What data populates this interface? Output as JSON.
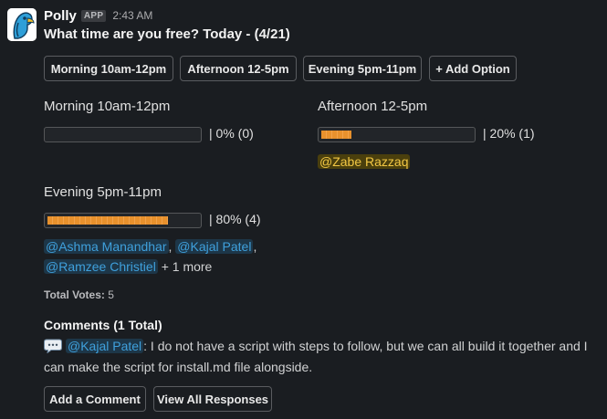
{
  "message": {
    "sender": "Polly",
    "app_badge": "APP",
    "time": "2:43 AM"
  },
  "poll": {
    "question": "What time are you free? Today - (4/21)",
    "buttons": [
      {
        "label": "Morning 10am-12pm"
      },
      {
        "label": "Afternoon 12-5pm"
      },
      {
        "label": "Evening 5pm-11pm"
      },
      {
        "label": "+ Add Option"
      }
    ],
    "options": [
      {
        "title": "Morning 10am-12pm",
        "percent_text": "|  0% (0)",
        "fill_fraction": 0.0
      },
      {
        "title": "Afternoon 12-5pm",
        "percent_text": "|  20% (1)",
        "fill_fraction": 0.2,
        "voters": [
          "@Zabe Razzaq"
        ]
      },
      {
        "title": "Evening 5pm-11pm",
        "percent_text": "|  80% (4)",
        "fill_fraction": 0.8,
        "voters": [
          "@Ashma Manandhar",
          "@Kajal Patel",
          "@Ramzee Christiel"
        ],
        "more_text": "+ 1 more"
      }
    ],
    "total_votes_label": "Total Votes:",
    "total_votes_value": "5"
  },
  "comments": {
    "title": "Comments (1 Total)",
    "items": [
      {
        "author": "@Kajal Patel",
        "text": ": I do not have a script with steps to follow, but we can all build it together and I can make the script for install.md file alongside."
      }
    ]
  },
  "actions": {
    "add_comment": "Add a Comment",
    "view_all": "View All Responses"
  },
  "colors": {
    "background": "#1a1d21",
    "bar_fill": "#e8912d",
    "mention": "#3fa0dc",
    "self_mention": "#f2c744"
  }
}
